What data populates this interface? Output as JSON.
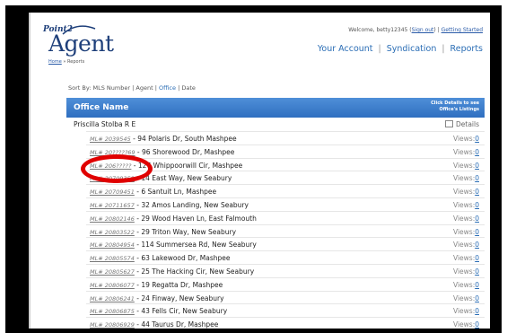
{
  "logo": {
    "small": "Point2",
    "main": "Agent"
  },
  "breadcrumb": {
    "home": "Home",
    "sep": " » ",
    "current": "Reports"
  },
  "welcome": {
    "prefix": "Welcome, betty12345 (",
    "sign_out": "Sign out",
    "mid": ") | ",
    "getting_started": "Getting Started"
  },
  "topnav": {
    "account": "Your Account",
    "syndication": "Syndication",
    "reports": "Reports",
    "sep": "|"
  },
  "sortby": {
    "label": "Sort By:",
    "mls": "MLS Number",
    "agent": "Agent",
    "office": "Office",
    "date": "Date",
    "sep": "|"
  },
  "table": {
    "header_name": "Office Name",
    "header_hint": "Click Details to see Office's Listings",
    "office": "Priscilla Stolba R E",
    "details_label": "Details",
    "views_label": "Views:",
    "listings": [
      {
        "mls": "ML# 2039545",
        "address": "94 Polaris Dr, South Mashpee",
        "views": "0"
      },
      {
        "mls": "ML# 20?????69",
        "address": "96 Shorewood Dr, Mashpee",
        "views": "0"
      },
      {
        "mls": "ML# 206?????",
        "address": "127 Whippoorwill Cir, Mashpee",
        "views": "0"
      },
      {
        "mls": "ML# 20709359",
        "address": "14 East Way, New Seabury",
        "views": "0"
      },
      {
        "mls": "ML# 20709451",
        "address": "6 Santuit Ln, Mashpee",
        "views": "0"
      },
      {
        "mls": "ML# 20711657",
        "address": "32 Amos Landing, New Seabury",
        "views": "0"
      },
      {
        "mls": "ML# 20802146",
        "address": "29 Wood Haven Ln, East Falmouth",
        "views": "0"
      },
      {
        "mls": "ML# 20803522",
        "address": "29 Triton Way, New Seabury",
        "views": "0"
      },
      {
        "mls": "ML# 20804954",
        "address": "114 Summersea Rd, New Seabury",
        "views": "0"
      },
      {
        "mls": "ML# 20805574",
        "address": "63 Lakewood Dr, Mashpee",
        "views": "0"
      },
      {
        "mls": "ML# 20805627",
        "address": "25 The Hacking Cir, New Seabury",
        "views": "0"
      },
      {
        "mls": "ML# 20806077",
        "address": "19 Regatta Dr, Mashpee",
        "views": "0"
      },
      {
        "mls": "ML# 20806241",
        "address": "24 Finway, New Seabury",
        "views": "0"
      },
      {
        "mls": "ML# 20806875",
        "address": "43 Fells Cir, New Seabury",
        "views": "0"
      },
      {
        "mls": "ML# 20806929",
        "address": "44 Taurus Dr, Mashpee",
        "views": "0"
      }
    ]
  },
  "colors": {
    "header_blue": "#2f6fc0",
    "link_blue": "#2a6db5",
    "annotation_red": "#e00000",
    "frame": "#000000"
  }
}
